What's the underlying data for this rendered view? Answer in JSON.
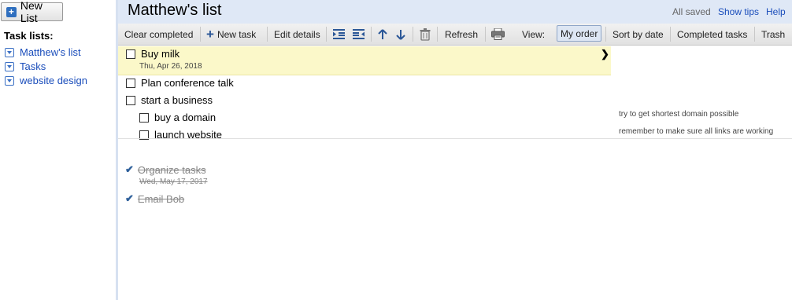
{
  "sidebar": {
    "new_list_label": "New List",
    "task_lists_label": "Task lists:",
    "lists": [
      {
        "label": "Matthew's list"
      },
      {
        "label": "Tasks"
      },
      {
        "label": "website design"
      }
    ]
  },
  "header": {
    "title": "Matthew's list",
    "saved_status": "All saved",
    "show_tips": "Show tips",
    "help": "Help"
  },
  "toolbar": {
    "clear_completed": "Clear completed",
    "new_task": "New task",
    "edit_details": "Edit details",
    "refresh": "Refresh",
    "view_label": "View:",
    "my_order": "My order",
    "sort_by_date": "Sort by date",
    "completed_tasks": "Completed tasks",
    "trash": "Trash"
  },
  "tasks": [
    {
      "title": "Buy milk",
      "date": "Thu, Apr 26, 2018",
      "note": ""
    },
    {
      "title": "Plan conference talk",
      "date": "",
      "note": ""
    },
    {
      "title": "start a business",
      "date": "",
      "note": ""
    },
    {
      "title": "buy a domain",
      "date": "",
      "note": "try to get shortest domain possible"
    },
    {
      "title": "launch website",
      "date": "",
      "note": "remember to make sure all links are working"
    },
    {
      "title": "Organize tasks",
      "date": "Wed, May 17, 2017",
      "note": ""
    },
    {
      "title": "Email Bob",
      "date": "",
      "note": ""
    }
  ],
  "colors": {
    "accent": "#1a4dbb",
    "header_bg": "#dfe8f6",
    "highlight": "#fbf8c9"
  }
}
